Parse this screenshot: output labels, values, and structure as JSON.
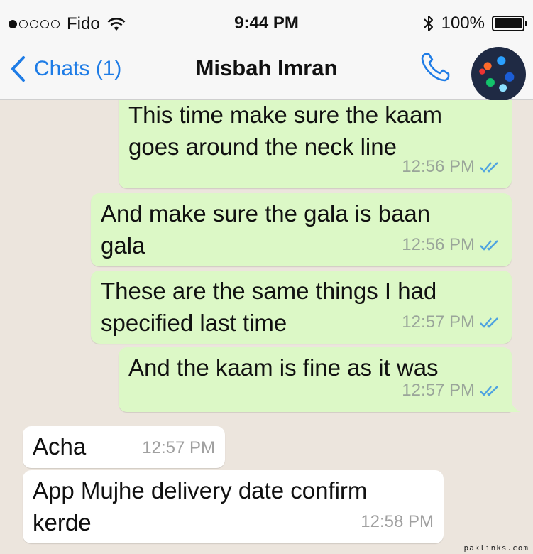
{
  "status_bar": {
    "carrier": "Fido",
    "time": "9:44 PM",
    "battery": "100%"
  },
  "header": {
    "back_label": "Chats (1)",
    "title": "Misbah Imran"
  },
  "messages": [
    {
      "direction": "out",
      "text": "This time make sure the kaam\ngoes around the neck line",
      "time": "12:56 PM"
    },
    {
      "direction": "out",
      "text": "And make sure the gala is baan\ngala",
      "time": "12:56 PM"
    },
    {
      "direction": "out",
      "text": "These are the same things I had\nspecified last time",
      "time": "12:57 PM"
    },
    {
      "direction": "out",
      "text": "And the kaam is fine as it was",
      "time": "12:57 PM"
    },
    {
      "direction": "in",
      "text": "Acha",
      "time": "12:57 PM"
    },
    {
      "direction": "in",
      "text": "App Mujhe delivery date confirm\nkerde",
      "time": "12:58 PM"
    }
  ],
  "watermark": "paklinks.com",
  "colors": {
    "accent": "#1e7ce6",
    "outgoing_bubble": "#dcf8c6",
    "incoming_bubble": "#ffffff",
    "read_ticks": "#4fa3e0"
  }
}
